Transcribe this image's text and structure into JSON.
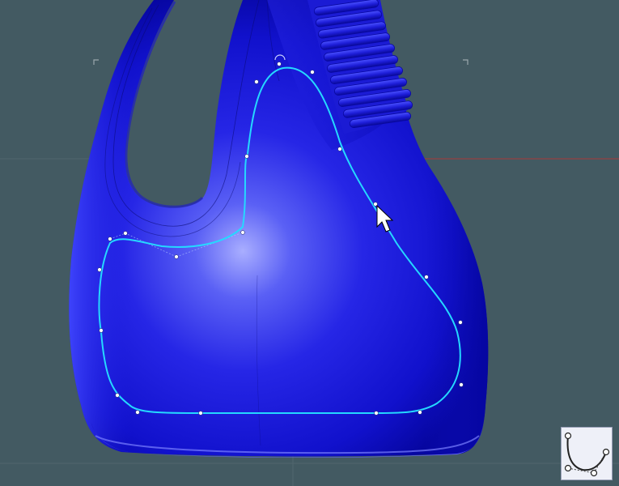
{
  "app": {
    "view": "perspective-viewport",
    "background_color": "#435a62",
    "grid_color": "#50666e",
    "axis_color": "#a83a3a"
  },
  "model": {
    "object": "detergent-bottle",
    "body_color": "#1616d8",
    "highlight_color": "#8e92ff",
    "shadow_color": "#0808a0"
  },
  "curve": {
    "type": "spline-curve",
    "color": "#25d8ff",
    "control_point_color": "#ffffff"
  },
  "cursor": {
    "icon": "arrow-cursor-icon"
  },
  "tool_panel": {
    "icon": "curve-edit-tool-icon",
    "background_color": "#eef0f8"
  }
}
